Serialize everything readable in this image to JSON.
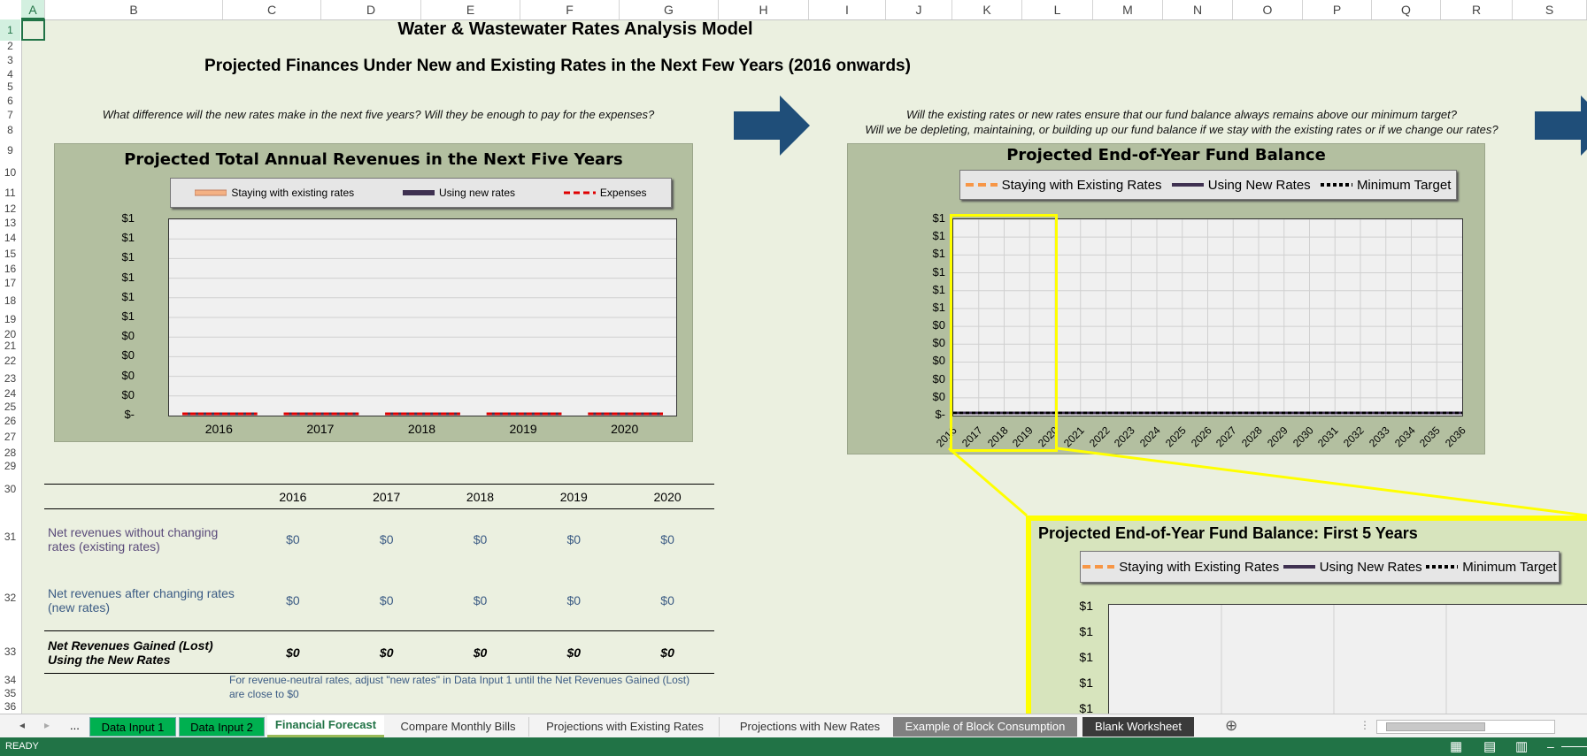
{
  "columns": [
    "A",
    "B",
    "C",
    "D",
    "E",
    "F",
    "G",
    "H",
    "I",
    "J",
    "K",
    "L",
    "M",
    "N",
    "O",
    "P",
    "Q",
    "R",
    "S"
  ],
  "rows": [
    "1",
    "2",
    "3",
    "4",
    "5",
    "6",
    "7",
    "8",
    "9",
    "10",
    "11",
    "12",
    "13",
    "14",
    "15",
    "16",
    "17",
    "18",
    "19",
    "20",
    "21",
    "22",
    "23",
    "24",
    "25",
    "26",
    "27",
    "28",
    "29",
    "30",
    "31",
    "32",
    "33",
    "34",
    "35",
    "36"
  ],
  "sheet": {
    "title": "Water & Wastewater Rates Analysis Model",
    "subtitle": "Projected Finances Under New and Existing Rates in the Next Few Years (2016 onwards)",
    "question_left": "What difference will the new rates make in the next five years? Will they be enough to pay for the expenses?",
    "question_right_1": "Will the existing rates or new rates ensure that our fund balance always remains above our minimum target?",
    "question_right_2": "Will we be depleting, maintaining, or building up our fund balance if we stay with the existing rates or if we change our rates?"
  },
  "chart_data": [
    {
      "type": "line",
      "title": "Projected Total Annual Revenues in the Next Five Years",
      "categories": [
        "2016",
        "2017",
        "2018",
        "2019",
        "2020"
      ],
      "series": [
        {
          "name": "Staying with existing rates",
          "values": [
            0,
            0,
            0,
            0,
            0
          ]
        },
        {
          "name": "Using new rates",
          "values": [
            0,
            0,
            0,
            0,
            0
          ]
        },
        {
          "name": "Expenses",
          "values": [
            0,
            0,
            0,
            0,
            0
          ]
        }
      ],
      "yticks": [
        "$-",
        "$0",
        "$0",
        "$0",
        "$0",
        "$1",
        "$1",
        "$1",
        "$1",
        "$1",
        "$1"
      ],
      "legend": "top",
      "colors": {
        "existing": "#f4b183",
        "new": "#3f3151",
        "expenses": "#e00000"
      }
    },
    {
      "type": "line",
      "title": "Projected End-of-Year Fund Balance",
      "categories": [
        "2016",
        "2017",
        "2018",
        "2019",
        "2020",
        "2021",
        "2022",
        "2023",
        "2024",
        "2025",
        "2026",
        "2027",
        "2028",
        "2029",
        "2030",
        "2031",
        "2032",
        "2033",
        "2034",
        "2035",
        "2036"
      ],
      "series": [
        {
          "name": "Staying with Existing Rates",
          "values": [
            0,
            0,
            0,
            0,
            0,
            0,
            0,
            0,
            0,
            0,
            0,
            0,
            0,
            0,
            0,
            0,
            0,
            0,
            0,
            0,
            0
          ]
        },
        {
          "name": "Using New Rates",
          "values": [
            0,
            0,
            0,
            0,
            0,
            0,
            0,
            0,
            0,
            0,
            0,
            0,
            0,
            0,
            0,
            0,
            0,
            0,
            0,
            0,
            0
          ]
        },
        {
          "name": "Minimum Target",
          "values": [
            0,
            0,
            0,
            0,
            0,
            0,
            0,
            0,
            0,
            0,
            0,
            0,
            0,
            0,
            0,
            0,
            0,
            0,
            0,
            0,
            0
          ]
        }
      ],
      "yticks": [
        "$-",
        "$0",
        "$0",
        "$0",
        "$0",
        "$0",
        "$1",
        "$1",
        "$1",
        "$1",
        "$1",
        "$1"
      ],
      "legend": "top",
      "colors": {
        "existing": "#f79646",
        "new": "#3f3151",
        "target": "#000000"
      }
    },
    {
      "type": "line",
      "title": "Projected End-of-Year Fund Balance: First 5 Years",
      "series": [
        {
          "name": "Staying with Existing Rates"
        },
        {
          "name": "Using New Rates"
        },
        {
          "name": "Minimum Target"
        }
      ],
      "yticks": [
        "$1",
        "$1",
        "$1",
        "$1",
        "$1"
      ],
      "legend": "top"
    }
  ],
  "table": {
    "years": [
      "2016",
      "2017",
      "2018",
      "2019",
      "2020"
    ],
    "rows": [
      {
        "label": "Net revenues without changing rates (existing rates)",
        "values": [
          "$0",
          "$0",
          "$0",
          "$0",
          "$0"
        ]
      },
      {
        "label": "Net revenues after changing rates (new rates)",
        "values": [
          "$0",
          "$0",
          "$0",
          "$0",
          "$0"
        ]
      },
      {
        "label": "Net Revenues Gained (Lost) Using the New Rates",
        "values": [
          "$0",
          "$0",
          "$0",
          "$0",
          "$0"
        ]
      }
    ],
    "note": "For revenue-neutral rates, adjust \"new rates\" in Data Input 1 until the Net Revenues Gained (Lost) are close to $0"
  },
  "tabs": {
    "ellipsis": "...",
    "items": [
      "Data Input 1",
      "Data Input 2",
      "Financial Forecast",
      "Compare Monthly Bills",
      "Projections with Existing Rates",
      "Projections with New Rates",
      "Example of Block Consumption",
      "Blank Worksheet"
    ],
    "add": "⊕"
  },
  "status": {
    "ready": "READY",
    "zoom_minus": "–"
  }
}
